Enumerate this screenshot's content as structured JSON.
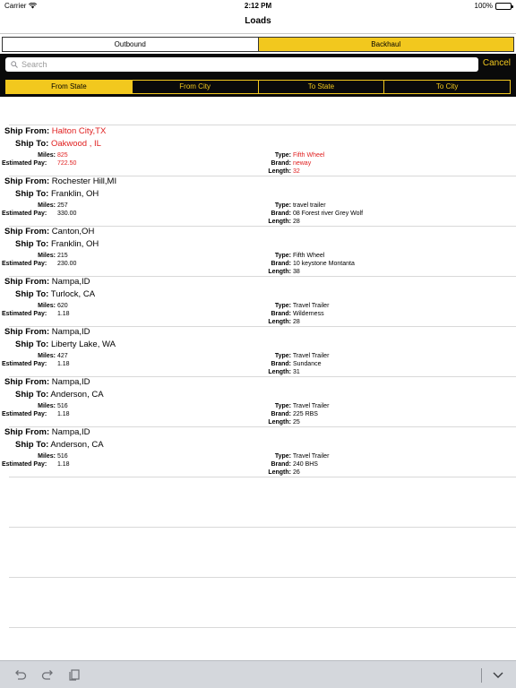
{
  "status_bar": {
    "carrier": "Carrier",
    "time": "2:12 PM",
    "battery": "100%"
  },
  "nav": {
    "title": "Loads"
  },
  "segment": {
    "outbound": "Outbound",
    "backhaul": "Backhaul",
    "selected": "Backhaul"
  },
  "search": {
    "placeholder": "Search",
    "value": "",
    "cancel": "Cancel"
  },
  "filters": {
    "items": [
      "From State",
      "From City",
      "To State",
      "To City"
    ],
    "selected": "From State"
  },
  "labels": {
    "ship_from": "Ship From:",
    "ship_to": "Ship To:",
    "miles": "Miles:",
    "pay": "Estimated Pay:",
    "type": "Type:",
    "brand": "Brand:",
    "length": "Length:"
  },
  "colors": {
    "accent": "#f2c81e",
    "highlight": "#e02020",
    "panel": "#0a0a0a"
  },
  "loads": [
    {
      "from": "Halton City,TX",
      "to": "Oakwood , IL",
      "miles": "825",
      "pay": "722.50",
      "type": "Fifth Wheel",
      "brand": "neway",
      "length": "32",
      "highlighted": true
    },
    {
      "from": "Rochester Hill,MI",
      "to": "Franklin, OH",
      "miles": "257",
      "pay": "330.00",
      "type": "travel trailer",
      "brand": "08 Forest river Grey Wolf",
      "length": "28"
    },
    {
      "from": "Canton,OH",
      "to": "Franklin, OH",
      "miles": "215",
      "pay": "230.00",
      "type": "Fifth Wheel",
      "brand": "10 keystone Montanta",
      "length": "38"
    },
    {
      "from": "Nampa,ID",
      "to": "Turlock, CA",
      "miles": "620",
      "pay": "1.18",
      "type": "Travel Trailer",
      "brand": "Wilderness",
      "length": "28"
    },
    {
      "from": "Nampa,ID",
      "to": "Liberty Lake, WA",
      "miles": "427",
      "pay": "1.18",
      "type": "Travel Trailer",
      "brand": "Sundance",
      "length": "31"
    },
    {
      "from": "Nampa,ID",
      "to": "Anderson, CA",
      "miles": "516",
      "pay": "1.18",
      "type": "Travel Trailer",
      "brand": "225 RBS",
      "length": "25"
    },
    {
      "from": "Nampa,ID",
      "to": "Anderson, CA",
      "miles": "516",
      "pay": "1.18",
      "type": "Travel Trailer",
      "brand": "240 BHS",
      "length": "26"
    }
  ],
  "toolbar": {
    "icons": [
      "undo-icon",
      "redo-icon",
      "paste-icon",
      "chevron-down-icon"
    ]
  }
}
